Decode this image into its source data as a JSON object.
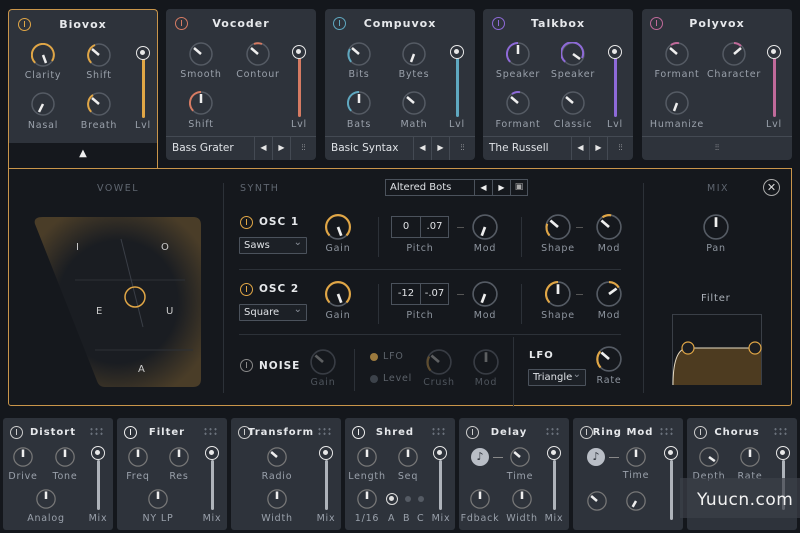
{
  "voice_modules": [
    {
      "name": "Biovox",
      "color": "#e0a646",
      "knobs": [
        "Clarity",
        "Shift",
        "Nasal",
        "Breath"
      ],
      "level_label": "Lvl",
      "selected": true
    },
    {
      "name": "Vocoder",
      "color": "#d67b63",
      "knobs": [
        "Smooth",
        "Contour",
        "Shift"
      ],
      "level_label": "Lvl",
      "preset": "Bass Grater"
    },
    {
      "name": "Compuvox",
      "color": "#5fa8c0",
      "knobs": [
        "Bits",
        "Bytes",
        "Bats",
        "Math"
      ],
      "level_label": "Lvl",
      "preset": "Basic Syntax"
    },
    {
      "name": "Talkbox",
      "color": "#8e6ad8",
      "knobs": [
        "Speaker",
        "Speaker",
        "Formant",
        "Classic"
      ],
      "level_label": "Lvl",
      "preset": "The Russell"
    },
    {
      "name": "Polyvox",
      "color": "#c06a9a",
      "knobs": [
        "Formant",
        "Character",
        "Humanize"
      ],
      "level_label": "Lvl"
    }
  ],
  "editor": {
    "vowel": {
      "section": "VOWEL",
      "letters": [
        "I",
        "O",
        "E",
        "U",
        "A"
      ]
    },
    "synth": {
      "section": "SYNTH",
      "preset": "Altered Bots",
      "osc1": {
        "label": "OSC 1",
        "wave": "Saws",
        "gain": "Gain",
        "pitch": [
          "0",
          ".07"
        ],
        "pitch_label": "Pitch",
        "mod": "Mod",
        "shape": "Shape",
        "shape_mod": "Mod"
      },
      "osc2": {
        "label": "OSC 2",
        "wave": "Square",
        "gain": "Gain",
        "pitch": [
          "-12",
          "-.07"
        ],
        "pitch_label": "Pitch",
        "mod": "Mod",
        "shape": "Shape",
        "shape_mod": "Mod"
      },
      "noise": {
        "label": "NOISE",
        "gain": "Gain",
        "lfo_opt": "LFO",
        "level_opt": "Level",
        "crush": "Crush",
        "mod": "Mod"
      },
      "lfo": {
        "label": "LFO",
        "wave": "Triangle",
        "rate": "Rate"
      }
    },
    "mix": {
      "section": "MIX",
      "pan": "Pan",
      "filter": "Filter"
    }
  },
  "effects": [
    {
      "name": "Distort",
      "knobs": [
        "Drive",
        "Tone",
        "Analog"
      ],
      "mix": "Mix"
    },
    {
      "name": "Filter",
      "knobs": [
        "Freq",
        "Res",
        "NY LP"
      ],
      "mix": "Mix"
    },
    {
      "name": "Transform",
      "knobs": [
        "Radio",
        "Width"
      ],
      "mix": "Mix"
    },
    {
      "name": "Shred",
      "knobs": [
        "Length",
        "Seq",
        "1/16"
      ],
      "steps": [
        "A",
        "B",
        "C"
      ],
      "mix": "Mix"
    },
    {
      "name": "Delay",
      "knobs": [
        "Time",
        "Fdback",
        "Width"
      ],
      "mix": "Mix"
    },
    {
      "name": "Ring Mod",
      "knobs": [
        "Time"
      ]
    },
    {
      "name": "Chorus",
      "knobs": [
        "Depth",
        "Rate"
      ]
    }
  ],
  "watermark": "Yuucn.com"
}
